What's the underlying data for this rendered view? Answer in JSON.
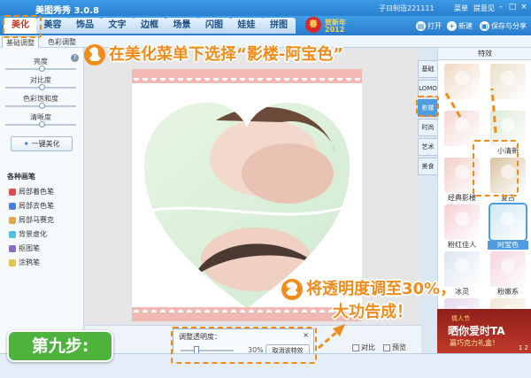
{
  "app": {
    "title": "美图秀秀 3.0.8",
    "user": "子曰制造221111",
    "menu": "菜单",
    "feedback": "提意见"
  },
  "banner": {
    "seal": "春",
    "line1": "贺新年",
    "line2": "2012"
  },
  "nav": {
    "tabs": [
      "美化",
      "美容",
      "饰品",
      "文字",
      "边框",
      "场景",
      "闪图",
      "娃娃",
      "拼图"
    ],
    "active": "美化",
    "open_label": "打开",
    "new_label": "新建",
    "save_label": "保存与分享"
  },
  "subtabs": [
    "基础调整",
    "色彩调整"
  ],
  "sliders": [
    {
      "label": "亮度",
      "level": 0.5
    },
    {
      "label": "对比度",
      "level": 0.5
    },
    {
      "label": "色彩饱和度",
      "level": 0.5
    },
    {
      "label": "清晰度",
      "level": 0.5
    }
  ],
  "onekey_label": "一键美化",
  "brushes": {
    "title": "各种画笔",
    "items": [
      {
        "label": "局部着色笔",
        "color": "#e24c4c"
      },
      {
        "label": "局部去色笔",
        "color": "#4c7ee2"
      },
      {
        "label": "局部马赛克",
        "color": "#e2a84c"
      },
      {
        "label": "背景虚化",
        "color": "#4cc2e2"
      },
      {
        "label": "抠图笔",
        "color": "#8a6bc8"
      },
      {
        "label": "涂鸦笔",
        "color": "#e2c44c"
      }
    ]
  },
  "categories": {
    "items": [
      "基础",
      "LOMO",
      "影楼",
      "时尚",
      "艺术",
      "美食"
    ],
    "active": "影楼"
  },
  "effects": {
    "header": "特效",
    "items": [
      {
        "label": "",
        "color": "#f0d9c8"
      },
      {
        "label": "",
        "color": "#e8e0c9"
      },
      {
        "label": "",
        "color": "#f4d7d5"
      },
      {
        "label": "小清新",
        "color": "#dde9d6"
      },
      {
        "label": "经典影楼",
        "color": "#f2cfc9"
      },
      {
        "label": "复古",
        "color": "#d9c3a4"
      },
      {
        "label": "粉红佳人",
        "color": "#f6cfd6"
      },
      {
        "label": "阿宝色",
        "color": "#cfe8f2"
      },
      {
        "label": "冰灵",
        "color": "#dbe5f0"
      },
      {
        "label": "粉嫩系",
        "color": "#f4d4e0"
      },
      {
        "label": "",
        "color": "#e6d7ef"
      },
      {
        "label": "",
        "color": "#f1e6d3"
      }
    ],
    "selected": "阿宝色"
  },
  "opacity_panel": {
    "title": "调整透明度：",
    "close": "×",
    "value": "30%",
    "level": 0.3,
    "cancel_label": "取消该特效"
  },
  "bottom_buttons": {
    "compare": "对比",
    "preview": "预览"
  },
  "ad": {
    "line1": "情人节",
    "line2": "晒你爱时TA",
    "line3": "赢巧克力礼盒！",
    "page": "1 2"
  },
  "step_badge": "第九步:",
  "annotations": {
    "one_num": "1",
    "one_text": "在美化菜单下选择“影楼-阿宝色”",
    "two_num": "2",
    "two_text_line1": "将透明度调至30%，",
    "two_text_line2": "大功告成！"
  },
  "colors": {
    "accent": "#f08c1c",
    "step_green": "#4db33d",
    "ui_blue": "#2a7bcc",
    "frame_pink": "#f2b8b4"
  }
}
